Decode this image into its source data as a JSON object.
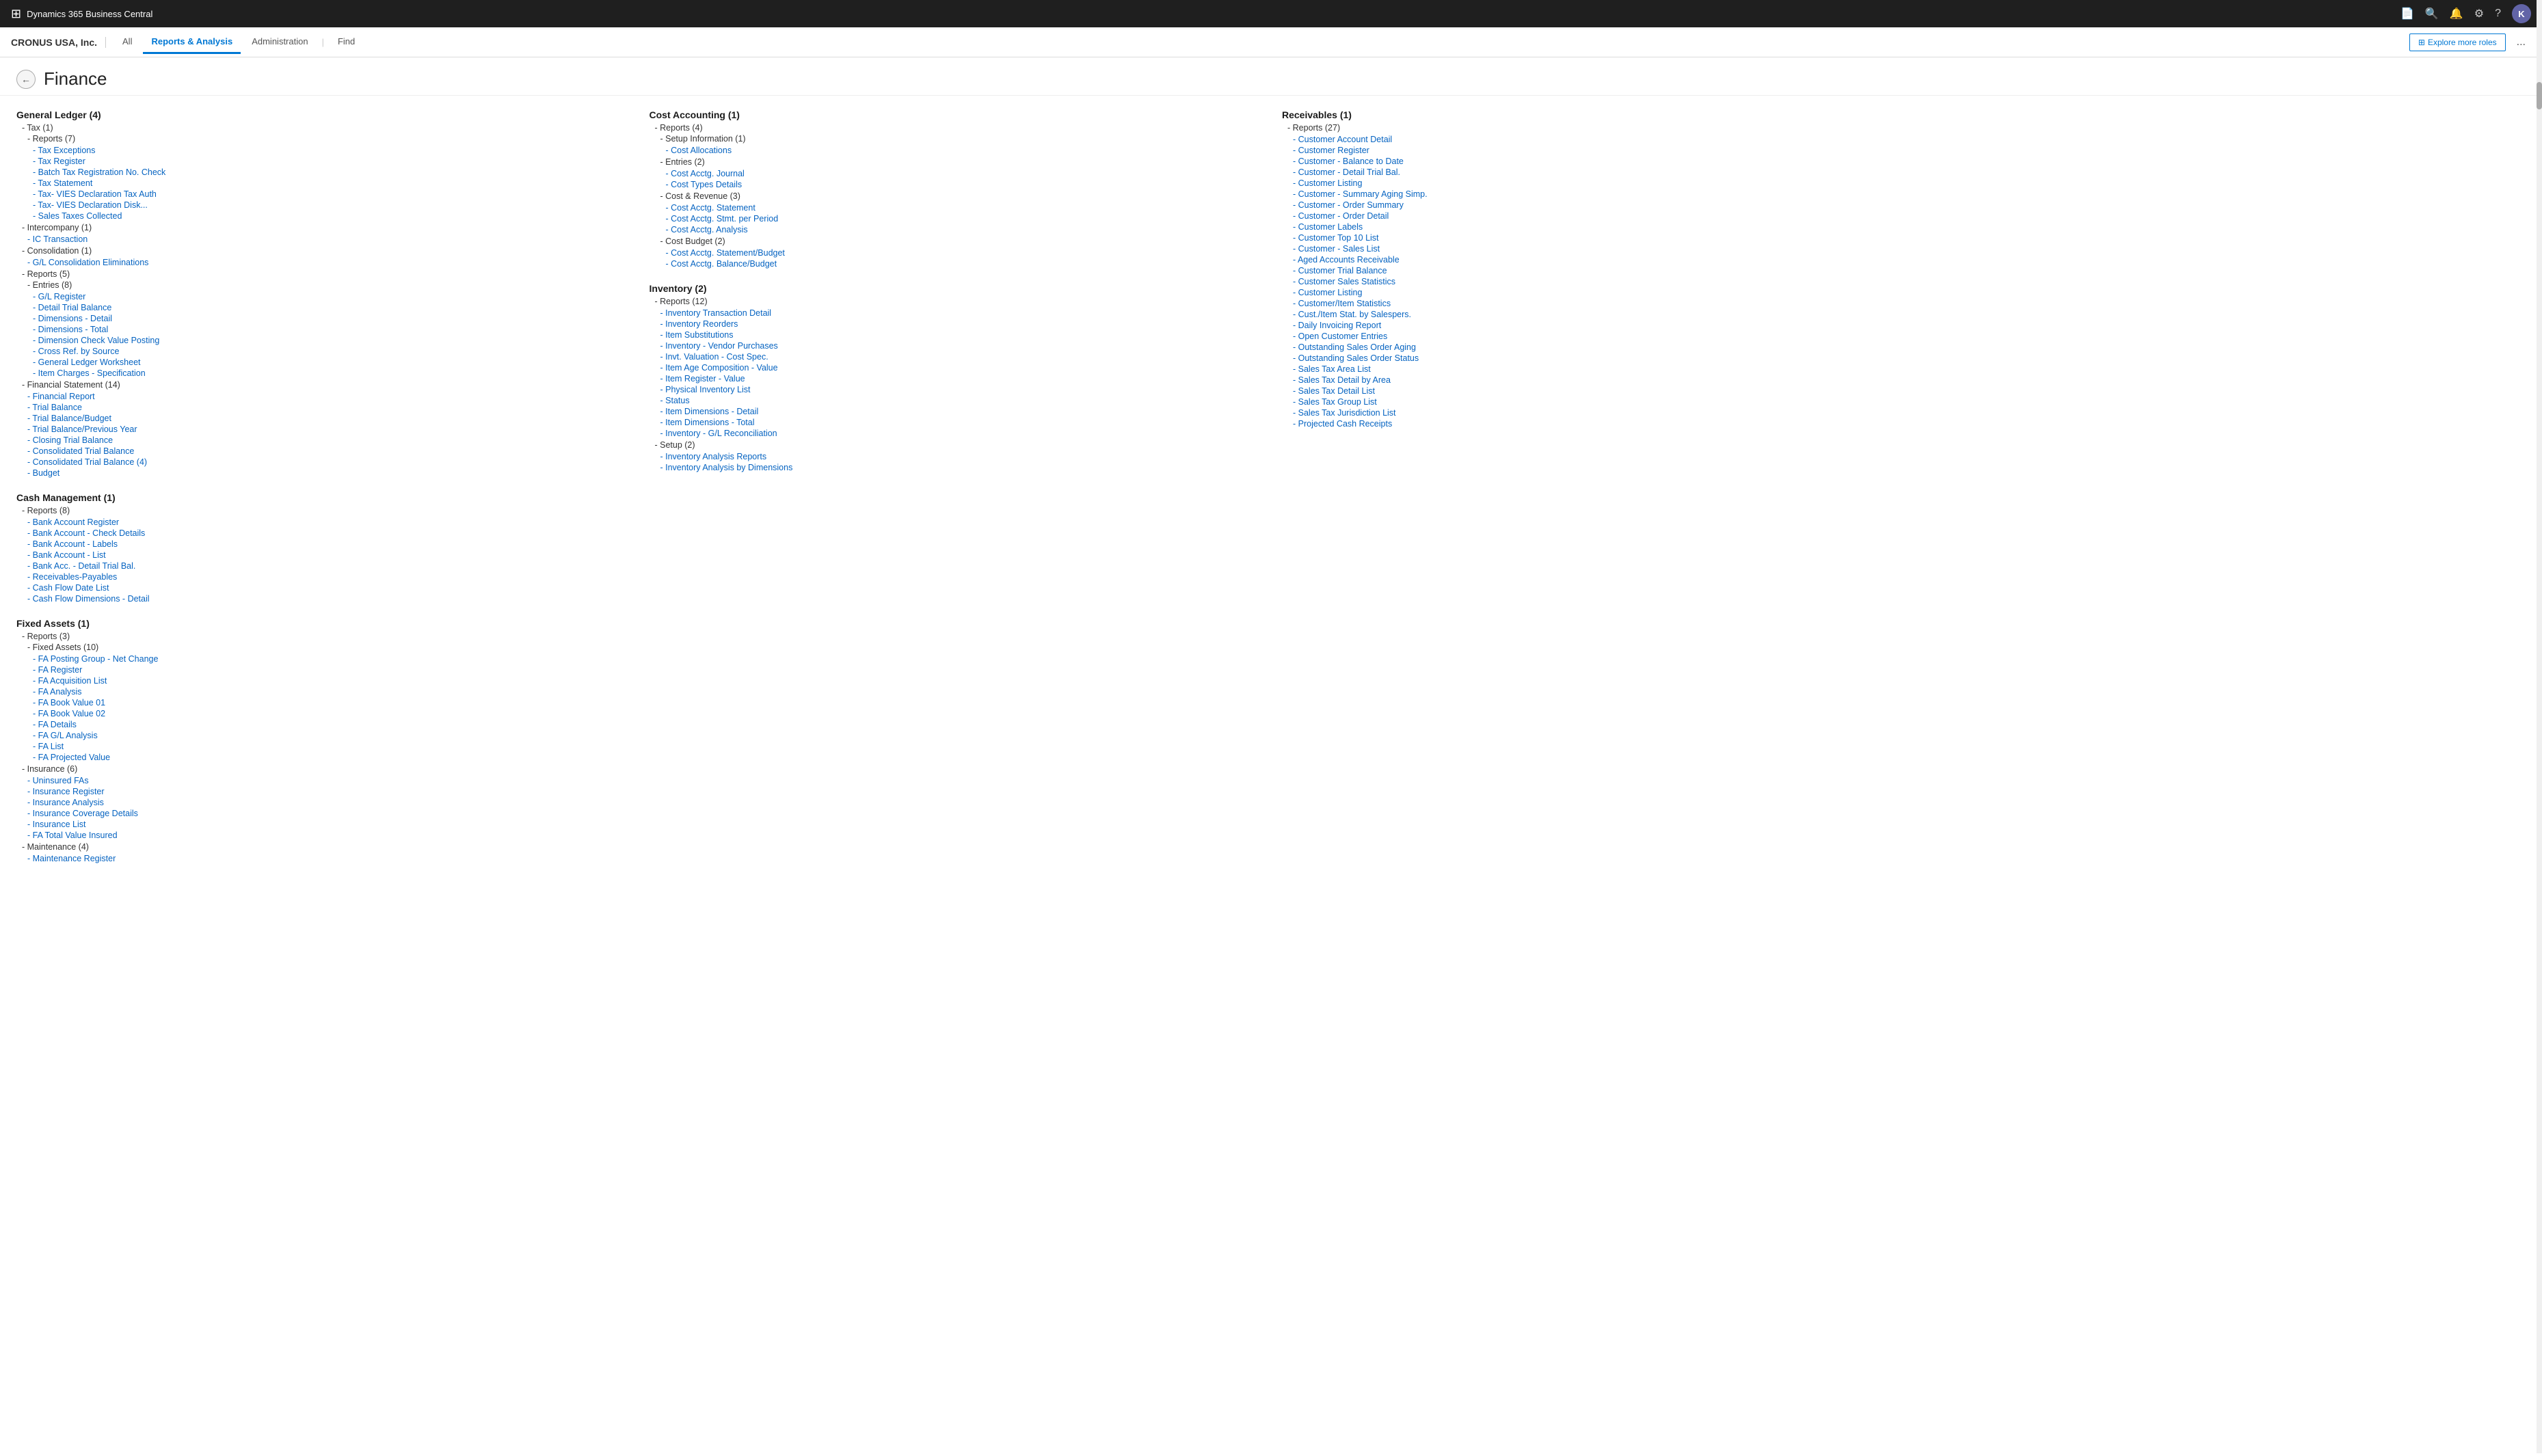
{
  "topBar": {
    "appName": "Dynamics 365 Business Central",
    "avatarInitial": "K"
  },
  "subNav": {
    "company": "CRONUS USA, Inc.",
    "tabs": [
      "All",
      "Reports & Analysis",
      "Administration",
      "Find"
    ],
    "activeTab": "Reports & Analysis",
    "exploreBtn": "Explore more roles",
    "moreBtn": "..."
  },
  "page": {
    "title": "Finance",
    "backLabel": "←"
  },
  "columns": [
    {
      "id": "general-ledger",
      "header": "General Ledger (4)",
      "groups": [
        {
          "label": "- Tax (1)",
          "indent": 0,
          "children": [
            {
              "label": "- Reports (7)",
              "indent": 1,
              "isLink": false
            },
            {
              "label": "- Tax Exceptions",
              "indent": 2,
              "isLink": true
            },
            {
              "label": "- Tax Register",
              "indent": 2,
              "isLink": true
            },
            {
              "label": "- Batch Tax Registration No. Check",
              "indent": 2,
              "isLink": true
            },
            {
              "label": "- Tax Statement",
              "indent": 2,
              "isLink": true
            },
            {
              "label": "- Tax- VIES Declaration Tax Auth",
              "indent": 2,
              "isLink": true
            },
            {
              "label": "- Tax- VIES Declaration Disk...",
              "indent": 2,
              "isLink": true
            },
            {
              "label": "- Sales Taxes Collected",
              "indent": 2,
              "isLink": true
            }
          ]
        },
        {
          "label": "- Intercompany (1)",
          "indent": 0,
          "children": [
            {
              "label": "- IC Transaction",
              "indent": 2,
              "isLink": true
            }
          ]
        },
        {
          "label": "- Consolidation (1)",
          "indent": 0,
          "children": [
            {
              "label": "- G/L Consolidation Eliminations",
              "indent": 2,
              "isLink": true
            }
          ]
        },
        {
          "label": "- Reports (5)",
          "indent": 0,
          "children": [
            {
              "label": "- Entries (8)",
              "indent": 1,
              "isLink": false
            },
            {
              "label": "- G/L Register",
              "indent": 2,
              "isLink": true
            },
            {
              "label": "- Detail Trial Balance",
              "indent": 2,
              "isLink": true
            },
            {
              "label": "- Dimensions - Detail",
              "indent": 2,
              "isLink": true
            },
            {
              "label": "- Dimensions - Total",
              "indent": 2,
              "isLink": true
            },
            {
              "label": "- Dimension Check Value Posting",
              "indent": 2,
              "isLink": true
            },
            {
              "label": "- Cross Ref. by Source",
              "indent": 2,
              "isLink": true
            },
            {
              "label": "- General Ledger Worksheet",
              "indent": 2,
              "isLink": true
            },
            {
              "label": "- Item Charges - Specification",
              "indent": 2,
              "isLink": true
            }
          ]
        },
        {
          "label": "- Financial Statement (14)",
          "indent": 0,
          "children": [
            {
              "label": "- Financial Report",
              "indent": 2,
              "isLink": true
            },
            {
              "label": "- Trial Balance",
              "indent": 2,
              "isLink": true
            },
            {
              "label": "- Trial Balance/Budget",
              "indent": 2,
              "isLink": true
            },
            {
              "label": "- Trial Balance/Previous Year",
              "indent": 2,
              "isLink": true
            },
            {
              "label": "- Closing Trial Balance",
              "indent": 2,
              "isLink": true
            },
            {
              "label": "- Consolidated Trial Balance",
              "indent": 2,
              "isLink": true
            },
            {
              "label": "- Consolidated Trial Balance (4)",
              "indent": 2,
              "isLink": true
            },
            {
              "label": "- Budget",
              "indent": 2,
              "isLink": true
            }
          ]
        }
      ]
    },
    {
      "id": "cash-management",
      "header": "Cash Management (1)",
      "groups": [
        {
          "label": "- Reports (8)",
          "indent": 0,
          "children": [
            {
              "label": "- Bank Account Register",
              "indent": 2,
              "isLink": true
            },
            {
              "label": "- Bank Account - Check Details",
              "indent": 2,
              "isLink": true
            },
            {
              "label": "- Bank Account - Labels",
              "indent": 2,
              "isLink": true
            },
            {
              "label": "- Bank Account - List",
              "indent": 2,
              "isLink": true
            },
            {
              "label": "- Bank Acc. - Detail Trial Bal.",
              "indent": 2,
              "isLink": true
            },
            {
              "label": "- Receivables-Payables",
              "indent": 2,
              "isLink": true
            },
            {
              "label": "- Cash Flow Date List",
              "indent": 2,
              "isLink": true
            },
            {
              "label": "- Cash Flow Dimensions - Detail",
              "indent": 2,
              "isLink": true
            }
          ]
        }
      ]
    },
    {
      "id": "fixed-assets",
      "header": "Fixed Assets (1)",
      "groups": [
        {
          "label": "- Reports (3)",
          "indent": 0,
          "children": [
            {
              "label": "- Fixed Assets (10)",
              "indent": 1,
              "isLink": false
            },
            {
              "label": "- FA Posting Group - Net Change",
              "indent": 2,
              "isLink": true
            },
            {
              "label": "- FA Register",
              "indent": 2,
              "isLink": true
            },
            {
              "label": "- FA Acquisition List",
              "indent": 2,
              "isLink": true
            },
            {
              "label": "- FA Analysis",
              "indent": 2,
              "isLink": true
            },
            {
              "label": "- FA Book Value 01",
              "indent": 2,
              "isLink": true
            },
            {
              "label": "- FA Book Value 02",
              "indent": 2,
              "isLink": true
            },
            {
              "label": "- FA Details",
              "indent": 2,
              "isLink": true
            },
            {
              "label": "- FA G/L Analysis",
              "indent": 2,
              "isLink": true
            },
            {
              "label": "- FA List",
              "indent": 2,
              "isLink": true
            },
            {
              "label": "- FA Projected Value",
              "indent": 2,
              "isLink": true
            }
          ]
        },
        {
          "label": "- Insurance (6)",
          "indent": 0,
          "children": [
            {
              "label": "- Uninsured FAs",
              "indent": 2,
              "isLink": true
            },
            {
              "label": "- Insurance Register",
              "indent": 2,
              "isLink": true
            },
            {
              "label": "- Insurance Analysis",
              "indent": 2,
              "isLink": true
            },
            {
              "label": "- Insurance Coverage Details",
              "indent": 2,
              "isLink": true
            },
            {
              "label": "- Insurance List",
              "indent": 2,
              "isLink": true
            },
            {
              "label": "- FA Total Value Insured",
              "indent": 2,
              "isLink": true
            }
          ]
        },
        {
          "label": "- Maintenance (4)",
          "indent": 0,
          "children": [
            {
              "label": "- Maintenance Register",
              "indent": 2,
              "isLink": true
            }
          ]
        }
      ]
    },
    {
      "id": "cost-accounting",
      "header": "Cost Accounting (1)",
      "groups": [
        {
          "label": "- Reports (4)",
          "indent": 0,
          "children": [
            {
              "label": "- Setup Information (1)",
              "indent": 1,
              "isLink": false
            },
            {
              "label": "- Cost Allocations",
              "indent": 2,
              "isLink": true
            },
            {
              "label": "- Entries (2)",
              "indent": 1,
              "isLink": false
            },
            {
              "label": "- Cost Acctg. Journal",
              "indent": 2,
              "isLink": true
            },
            {
              "label": "- Cost Types Details",
              "indent": 2,
              "isLink": true
            },
            {
              "label": "- Cost & Revenue (3)",
              "indent": 1,
              "isLink": false
            },
            {
              "label": "- Cost Acctg. Statement",
              "indent": 2,
              "isLink": true
            },
            {
              "label": "- Cost Acctg. Stmt. per Period",
              "indent": 2,
              "isLink": true
            },
            {
              "label": "- Cost Acctg. Analysis",
              "indent": 2,
              "isLink": true
            },
            {
              "label": "- Cost Budget (2)",
              "indent": 1,
              "isLink": false
            },
            {
              "label": "- Cost Acctg. Statement/Budget",
              "indent": 2,
              "isLink": true
            },
            {
              "label": "- Cost Acctg. Balance/Budget",
              "indent": 2,
              "isLink": true
            }
          ]
        }
      ]
    },
    {
      "id": "inventory",
      "header": "Inventory (2)",
      "groups": [
        {
          "label": "- Reports (12)",
          "indent": 0,
          "children": [
            {
              "label": "- Inventory Transaction Detail",
              "indent": 2,
              "isLink": true
            },
            {
              "label": "- Inventory Reorders",
              "indent": 2,
              "isLink": true
            },
            {
              "label": "- Item Substitutions",
              "indent": 2,
              "isLink": true
            },
            {
              "label": "- Inventory - Vendor Purchases",
              "indent": 2,
              "isLink": true
            },
            {
              "label": "- Invt. Valuation - Cost Spec.",
              "indent": 2,
              "isLink": true
            },
            {
              "label": "- Item Age Composition - Value",
              "indent": 2,
              "isLink": true
            },
            {
              "label": "- Item Register - Value",
              "indent": 2,
              "isLink": true
            },
            {
              "label": "- Physical Inventory List",
              "indent": 2,
              "isLink": true
            },
            {
              "label": "- Status",
              "indent": 2,
              "isLink": true
            },
            {
              "label": "- Item Dimensions - Detail",
              "indent": 2,
              "isLink": true
            },
            {
              "label": "- Item Dimensions - Total",
              "indent": 2,
              "isLink": true
            },
            {
              "label": "- Inventory - G/L Reconciliation",
              "indent": 2,
              "isLink": true
            }
          ]
        },
        {
          "label": "- Setup (2)",
          "indent": 0,
          "children": [
            {
              "label": "- Inventory Analysis Reports",
              "indent": 2,
              "isLink": true
            },
            {
              "label": "- Inventory Analysis by Dimensions",
              "indent": 2,
              "isLink": true
            }
          ]
        }
      ]
    },
    {
      "id": "receivables",
      "header": "Receivables (1)",
      "groups": [
        {
          "label": "- Reports (27)",
          "indent": 0,
          "children": [
            {
              "label": "- Customer Account Detail",
              "indent": 2,
              "isLink": true
            },
            {
              "label": "- Customer Register",
              "indent": 2,
              "isLink": true
            },
            {
              "label": "- Customer - Balance to Date",
              "indent": 2,
              "isLink": true
            },
            {
              "label": "- Customer - Detail Trial Bal.",
              "indent": 2,
              "isLink": true
            },
            {
              "label": "- Customer Listing",
              "indent": 2,
              "isLink": true
            },
            {
              "label": "- Customer - Summary Aging Simp.",
              "indent": 2,
              "isLink": true
            },
            {
              "label": "- Customer - Order Summary",
              "indent": 2,
              "isLink": true
            },
            {
              "label": "- Customer - Order Detail",
              "indent": 2,
              "isLink": true
            },
            {
              "label": "- Customer Labels",
              "indent": 2,
              "isLink": true
            },
            {
              "label": "- Customer Top 10 List",
              "indent": 2,
              "isLink": true
            },
            {
              "label": "- Customer - Sales List",
              "indent": 2,
              "isLink": true
            },
            {
              "label": "- Aged Accounts Receivable",
              "indent": 2,
              "isLink": true
            },
            {
              "label": "- Customer Trial Balance",
              "indent": 2,
              "isLink": true
            },
            {
              "label": "- Customer Sales Statistics",
              "indent": 2,
              "isLink": true
            },
            {
              "label": "- Customer Listing",
              "indent": 2,
              "isLink": true
            },
            {
              "label": "- Customer/Item Statistics",
              "indent": 2,
              "isLink": true
            },
            {
              "label": "- Cust./Item Stat. by Salespers.",
              "indent": 2,
              "isLink": true
            },
            {
              "label": "- Daily Invoicing Report",
              "indent": 2,
              "isLink": true
            },
            {
              "label": "- Open Customer Entries",
              "indent": 2,
              "isLink": true
            },
            {
              "label": "- Outstanding Sales Order Aging",
              "indent": 2,
              "isLink": true
            },
            {
              "label": "- Outstanding Sales Order Status",
              "indent": 2,
              "isLink": true
            },
            {
              "label": "- Sales Tax Area List",
              "indent": 2,
              "isLink": true
            },
            {
              "label": "- Sales Tax Detail by Area",
              "indent": 2,
              "isLink": true
            },
            {
              "label": "- Sales Tax Detail List",
              "indent": 2,
              "isLink": true
            },
            {
              "label": "- Sales Tax Group List",
              "indent": 2,
              "isLink": true
            },
            {
              "label": "- Sales Tax Jurisdiction List",
              "indent": 2,
              "isLink": true
            },
            {
              "label": "- Projected Cash Receipts",
              "indent": 2,
              "isLink": true
            }
          ]
        }
      ]
    }
  ]
}
